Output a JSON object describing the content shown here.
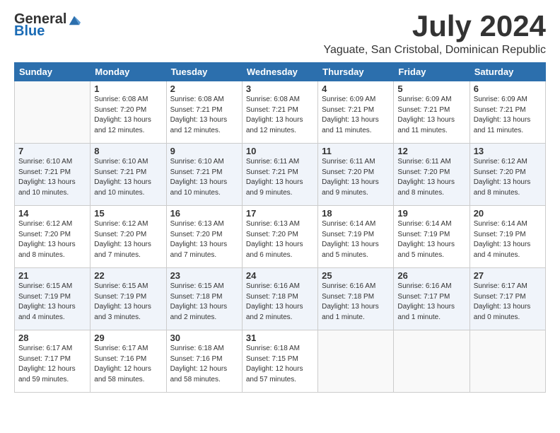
{
  "logo": {
    "general": "General",
    "blue": "Blue"
  },
  "title": "July 2024",
  "subtitle": "Yaguate, San Cristobal, Dominican Republic",
  "days_of_week": [
    "Sunday",
    "Monday",
    "Tuesday",
    "Wednesday",
    "Thursday",
    "Friday",
    "Saturday"
  ],
  "weeks": [
    [
      {
        "day": "",
        "sunrise": "",
        "sunset": "",
        "daylight": ""
      },
      {
        "day": "1",
        "sunrise": "6:08 AM",
        "sunset": "7:20 PM",
        "daylight": "13 hours and 12 minutes."
      },
      {
        "day": "2",
        "sunrise": "6:08 AM",
        "sunset": "7:21 PM",
        "daylight": "13 hours and 12 minutes."
      },
      {
        "day": "3",
        "sunrise": "6:08 AM",
        "sunset": "7:21 PM",
        "daylight": "13 hours and 12 minutes."
      },
      {
        "day": "4",
        "sunrise": "6:09 AM",
        "sunset": "7:21 PM",
        "daylight": "13 hours and 11 minutes."
      },
      {
        "day": "5",
        "sunrise": "6:09 AM",
        "sunset": "7:21 PM",
        "daylight": "13 hours and 11 minutes."
      },
      {
        "day": "6",
        "sunrise": "6:09 AM",
        "sunset": "7:21 PM",
        "daylight": "13 hours and 11 minutes."
      }
    ],
    [
      {
        "day": "7",
        "sunrise": "6:10 AM",
        "sunset": "7:21 PM",
        "daylight": "13 hours and 10 minutes."
      },
      {
        "day": "8",
        "sunrise": "6:10 AM",
        "sunset": "7:21 PM",
        "daylight": "13 hours and 10 minutes."
      },
      {
        "day": "9",
        "sunrise": "6:10 AM",
        "sunset": "7:21 PM",
        "daylight": "13 hours and 10 minutes."
      },
      {
        "day": "10",
        "sunrise": "6:11 AM",
        "sunset": "7:21 PM",
        "daylight": "13 hours and 9 minutes."
      },
      {
        "day": "11",
        "sunrise": "6:11 AM",
        "sunset": "7:20 PM",
        "daylight": "13 hours and 9 minutes."
      },
      {
        "day": "12",
        "sunrise": "6:11 AM",
        "sunset": "7:20 PM",
        "daylight": "13 hours and 8 minutes."
      },
      {
        "day": "13",
        "sunrise": "6:12 AM",
        "sunset": "7:20 PM",
        "daylight": "13 hours and 8 minutes."
      }
    ],
    [
      {
        "day": "14",
        "sunrise": "6:12 AM",
        "sunset": "7:20 PM",
        "daylight": "13 hours and 8 minutes."
      },
      {
        "day": "15",
        "sunrise": "6:12 AM",
        "sunset": "7:20 PM",
        "daylight": "13 hours and 7 minutes."
      },
      {
        "day": "16",
        "sunrise": "6:13 AM",
        "sunset": "7:20 PM",
        "daylight": "13 hours and 7 minutes."
      },
      {
        "day": "17",
        "sunrise": "6:13 AM",
        "sunset": "7:20 PM",
        "daylight": "13 hours and 6 minutes."
      },
      {
        "day": "18",
        "sunrise": "6:14 AM",
        "sunset": "7:19 PM",
        "daylight": "13 hours and 5 minutes."
      },
      {
        "day": "19",
        "sunrise": "6:14 AM",
        "sunset": "7:19 PM",
        "daylight": "13 hours and 5 minutes."
      },
      {
        "day": "20",
        "sunrise": "6:14 AM",
        "sunset": "7:19 PM",
        "daylight": "13 hours and 4 minutes."
      }
    ],
    [
      {
        "day": "21",
        "sunrise": "6:15 AM",
        "sunset": "7:19 PM",
        "daylight": "13 hours and 4 minutes."
      },
      {
        "day": "22",
        "sunrise": "6:15 AM",
        "sunset": "7:19 PM",
        "daylight": "13 hours and 3 minutes."
      },
      {
        "day": "23",
        "sunrise": "6:15 AM",
        "sunset": "7:18 PM",
        "daylight": "13 hours and 2 minutes."
      },
      {
        "day": "24",
        "sunrise": "6:16 AM",
        "sunset": "7:18 PM",
        "daylight": "13 hours and 2 minutes."
      },
      {
        "day": "25",
        "sunrise": "6:16 AM",
        "sunset": "7:18 PM",
        "daylight": "13 hours and 1 minute."
      },
      {
        "day": "26",
        "sunrise": "6:16 AM",
        "sunset": "7:17 PM",
        "daylight": "13 hours and 1 minute."
      },
      {
        "day": "27",
        "sunrise": "6:17 AM",
        "sunset": "7:17 PM",
        "daylight": "13 hours and 0 minutes."
      }
    ],
    [
      {
        "day": "28",
        "sunrise": "6:17 AM",
        "sunset": "7:17 PM",
        "daylight": "12 hours and 59 minutes."
      },
      {
        "day": "29",
        "sunrise": "6:17 AM",
        "sunset": "7:16 PM",
        "daylight": "12 hours and 58 minutes."
      },
      {
        "day": "30",
        "sunrise": "6:18 AM",
        "sunset": "7:16 PM",
        "daylight": "12 hours and 58 minutes."
      },
      {
        "day": "31",
        "sunrise": "6:18 AM",
        "sunset": "7:15 PM",
        "daylight": "12 hours and 57 minutes."
      },
      {
        "day": "",
        "sunrise": "",
        "sunset": "",
        "daylight": ""
      },
      {
        "day": "",
        "sunrise": "",
        "sunset": "",
        "daylight": ""
      },
      {
        "day": "",
        "sunrise": "",
        "sunset": "",
        "daylight": ""
      }
    ]
  ]
}
